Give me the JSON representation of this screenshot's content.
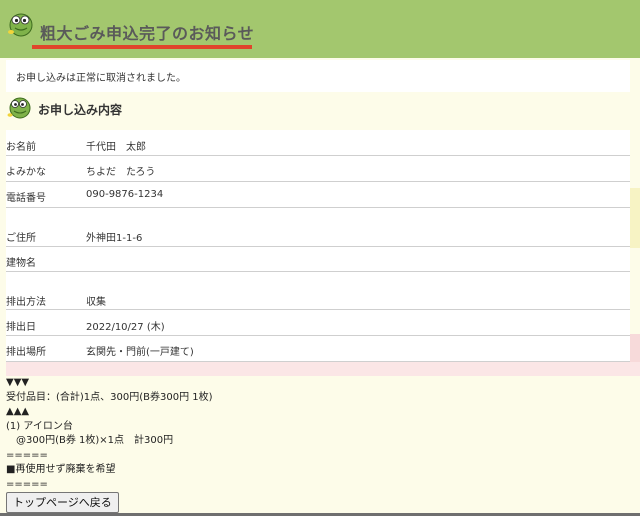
{
  "header": {
    "title": "粗大ごみ申込完了のお知らせ",
    "accent_color": "#e0452b",
    "bar_color": "#a3c76e",
    "logo_icon": "mascot-logo-icon"
  },
  "notice": {
    "text": "お申し込みは正常に取消されました。"
  },
  "section": {
    "title": "お申し込み内容",
    "logo_icon": "mascot-logo-icon"
  },
  "rows": [
    {
      "label": "お名前",
      "value": "千代田　太郎"
    },
    {
      "label": "よみかな",
      "value": "ちよだ　たろう"
    },
    {
      "label": "電話番号",
      "value": "090-9876-1234"
    },
    {
      "label": "ご住所",
      "value": "外神田1-1-6"
    },
    {
      "label": "建物名",
      "value": ""
    },
    {
      "label": "排出方法",
      "value": "収集"
    },
    {
      "label": "排出日",
      "value": "2022/10/27 (木)"
    },
    {
      "label": "排出場所",
      "value": "玄関先・門前(一戸建て)"
    }
  ],
  "details": {
    "line1": "▼▼▼",
    "line2": "受付品目：(合計)1点、300円(B券300円 1枚)",
    "line3": "▲▲▲",
    "line4": "(1) アイロン台",
    "line5": "　@300円(B券 1枚)×1点　計300円",
    "line6": "=====",
    "line7": "■再使用せず廃棄を希望",
    "line8": "====="
  },
  "back_button": {
    "label": "トップページへ戻る"
  }
}
